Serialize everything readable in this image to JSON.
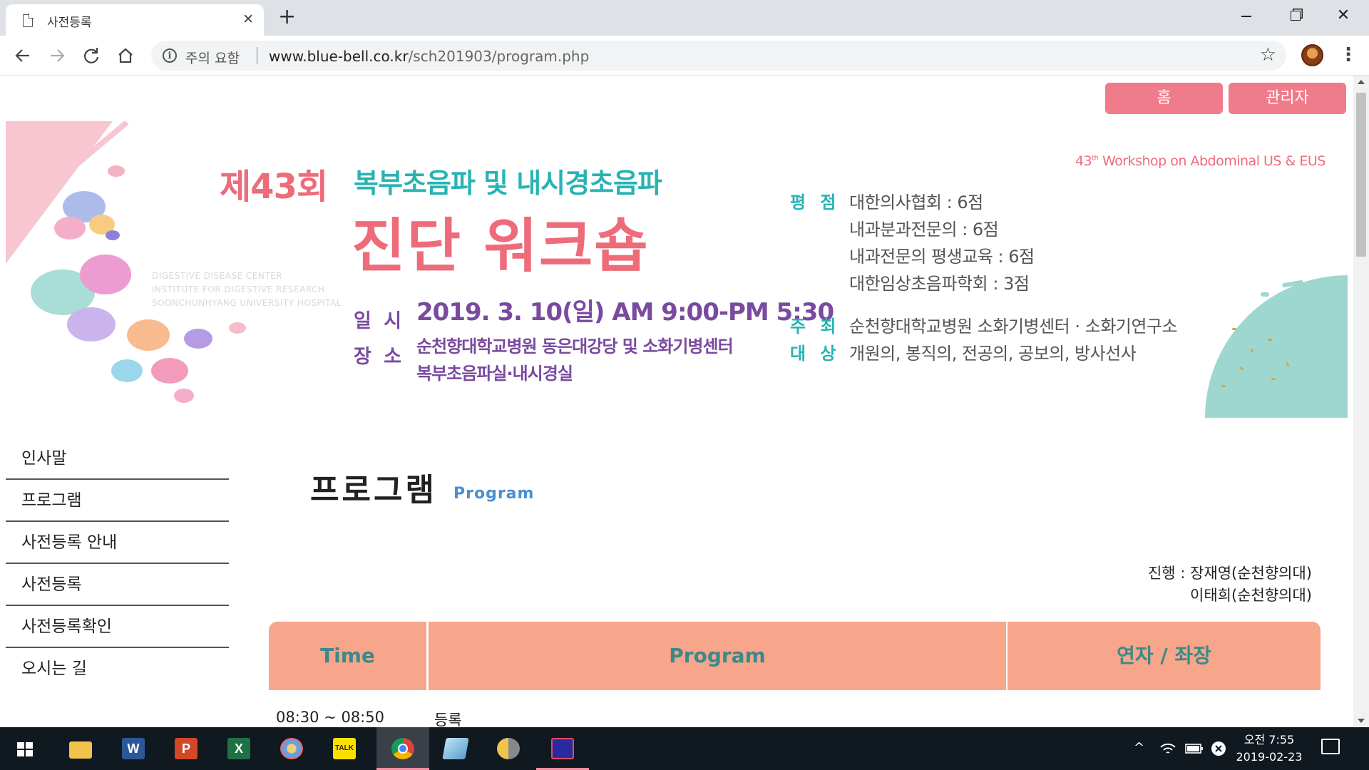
{
  "browser": {
    "tab_title": "사전등록",
    "tab_close": "✕",
    "new_tab": "+",
    "security_warning": "주의 요함",
    "url_domain": "www.blue-bell.co.kr",
    "url_path": "/sch201903/program.php",
    "bookmark_star": "☆",
    "menu": "⋮"
  },
  "header_buttons": {
    "home": "홈",
    "admin": "관리자"
  },
  "banner": {
    "edition": "제43회",
    "subtitle": "복부초음파 및 내시경초음파",
    "main_title": "진단 워크숍",
    "english_title_pre": "43",
    "english_title_sup": "th",
    "english_title_post": " Workshop on Abdominal US & EUS",
    "faint_line1": "DIGESTIVE DISEASE CENTER",
    "faint_line2": "INSTITUTE FOR DIGESTIVE RESEARCH",
    "faint_line3": "SOONCHUNHYANG UNIVERSITY HOSPITAL",
    "date_label": "일 시",
    "date_value": "2019. 3. 10(일) AM 9:00-PM 5:30",
    "place_label": "장 소",
    "place_line1": "순천향대학교병원 동은대강당 및 소화기병센터",
    "place_line2": "복부초음파실·내시경실",
    "credit_label": "평 점",
    "credits": [
      "대한의사협회 : 6점",
      "내과분과전문의 : 6점",
      "내과전문의 평생교육 : 6점",
      "대한임상초음파학회 : 3점"
    ],
    "host_label": "주 최",
    "host_value": "순천향대학교병원 소화기병센터 · 소화기연구소",
    "target_label": "대 상",
    "target_value": "개원의, 봉직의, 전공의, 공보의, 방사선사"
  },
  "side_menu": [
    "인사말",
    "프로그램",
    "사전등록 안내",
    "사전등록",
    "사전등록확인",
    "오시는 길"
  ],
  "content": {
    "title": "프로그램",
    "title_en": "Program",
    "chair_line1": "진행 : 장재영(순천향의대)",
    "chair_line2": "이태희(순천향의대)",
    "table": {
      "headers": [
        "Time",
        "Program",
        "연자 / 좌장"
      ],
      "rows": [
        {
          "time": "08:30 ~ 08:50",
          "program": "등록",
          "speaker": ""
        }
      ]
    }
  },
  "taskbar": {
    "kakao_label": "TALK",
    "word_label": "W",
    "ppt_label": "P",
    "excel_label": "X",
    "clock_time": "오전 7:55",
    "clock_date": "2019-02-23"
  },
  "colors": {
    "accent_pink": "#f07b8b",
    "table_header": "#f7a58b",
    "table_header_text": "#3a8a8a",
    "banner_teal": "#28b3b3",
    "banner_purple": "#7a4aa0"
  }
}
